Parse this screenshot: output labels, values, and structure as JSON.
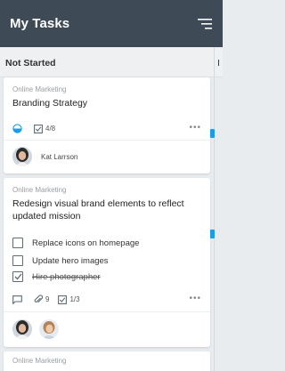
{
  "header": {
    "title": "My Tasks"
  },
  "column": {
    "title": "Not Started",
    "next_column_label": "I"
  },
  "cards": [
    {
      "category": "Online Marketing",
      "title": "Branding Strategy",
      "checklist_count": "4/8",
      "assignee": "Kat Larrson"
    },
    {
      "category": "Online Marketing",
      "title_line1": "Redesign visual brand elements to reflect",
      "title_line2": "updated mission",
      "checklist": [
        {
          "label": "Replace icons on homepage",
          "done": false
        },
        {
          "label": "Update hero images",
          "done": false
        },
        {
          "label": "Hire photographer",
          "done": true
        }
      ],
      "attachments": "9",
      "checklist_count": "1/3"
    },
    {
      "category": "Online Marketing"
    }
  ],
  "colors": {
    "header_bg": "#3e4a56",
    "accent": "#1a9ce8"
  }
}
